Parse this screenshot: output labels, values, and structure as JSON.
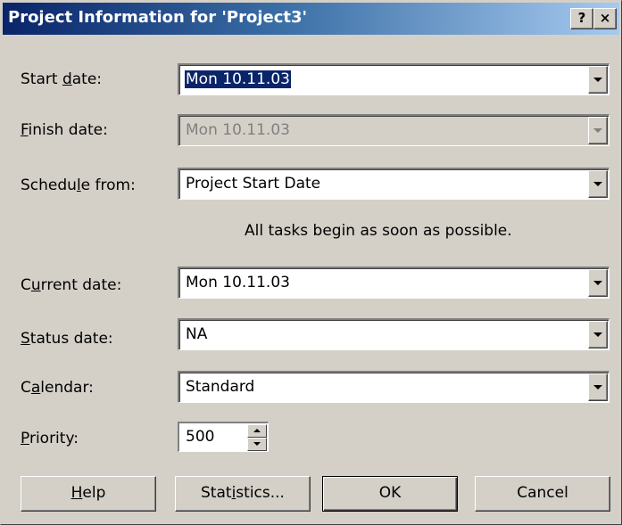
{
  "window": {
    "title": "Project Information for 'Project3'",
    "help_glyph": "?",
    "close_glyph": "×"
  },
  "fields": {
    "start_date": {
      "label_pre": "Start ",
      "label_key": "d",
      "label_post": "ate:",
      "value": "Mon 10.11.03"
    },
    "finish_date": {
      "label_pre": "",
      "label_key": "F",
      "label_post": "inish date:",
      "value": "Mon 10.11.03"
    },
    "schedule_from": {
      "label_pre": "Schedu",
      "label_key": "l",
      "label_post": "e from:",
      "value": "Project Start Date"
    },
    "current_date": {
      "label_pre": "C",
      "label_key": "u",
      "label_post": "rrent date:",
      "value": "Mon 10.11.03"
    },
    "status_date": {
      "label_pre": "",
      "label_key": "S",
      "label_post": "tatus date:",
      "value": "NA"
    },
    "calendar": {
      "label_pre": "C",
      "label_key": "a",
      "label_post": "lendar:",
      "value": "Standard"
    },
    "priority": {
      "label_pre": "",
      "label_key": "P",
      "label_post": "riority:",
      "value": "500"
    }
  },
  "info_text": "All tasks begin as soon as possible.",
  "buttons": {
    "help": {
      "pre": "",
      "key": "H",
      "post": "elp"
    },
    "statistics": {
      "pre": "Stat",
      "key": "i",
      "post": "stics..."
    },
    "ok": "OK",
    "cancel": "Cancel"
  },
  "icons": {
    "dropdown": "chevron-down-icon",
    "spin_up": "arrow-up-icon",
    "spin_down": "arrow-down-icon"
  },
  "colors": {
    "title_bar_start": "#0a246a",
    "title_bar_end": "#a6caf0",
    "dialog_face": "#d4d0c8",
    "selection": "#0a246a"
  }
}
